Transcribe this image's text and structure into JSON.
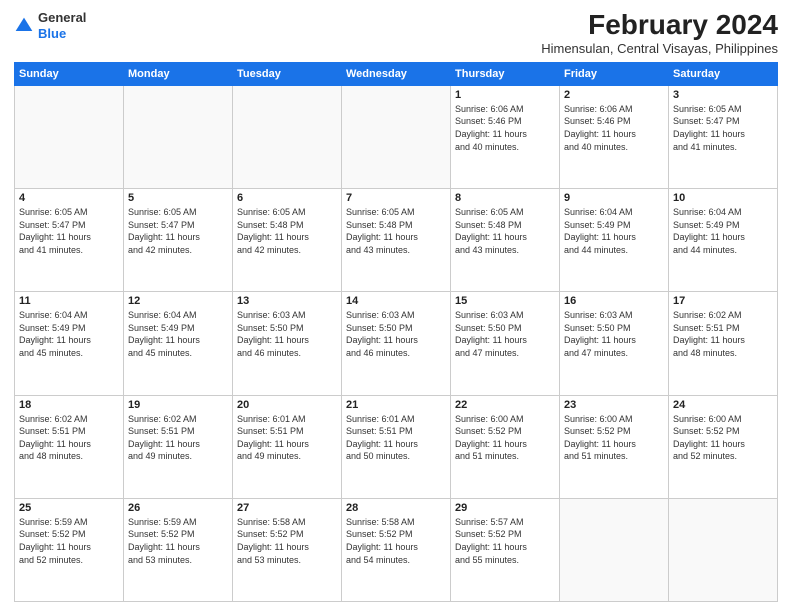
{
  "logo": {
    "general": "General",
    "blue": "Blue"
  },
  "header": {
    "month": "February 2024",
    "location": "Himensulan, Central Visayas, Philippines"
  },
  "weekdays": [
    "Sunday",
    "Monday",
    "Tuesday",
    "Wednesday",
    "Thursday",
    "Friday",
    "Saturday"
  ],
  "weeks": [
    [
      {
        "day": "",
        "info": ""
      },
      {
        "day": "",
        "info": ""
      },
      {
        "day": "",
        "info": ""
      },
      {
        "day": "",
        "info": ""
      },
      {
        "day": "1",
        "info": "Sunrise: 6:06 AM\nSunset: 5:46 PM\nDaylight: 11 hours\nand 40 minutes."
      },
      {
        "day": "2",
        "info": "Sunrise: 6:06 AM\nSunset: 5:46 PM\nDaylight: 11 hours\nand 40 minutes."
      },
      {
        "day": "3",
        "info": "Sunrise: 6:05 AM\nSunset: 5:47 PM\nDaylight: 11 hours\nand 41 minutes."
      }
    ],
    [
      {
        "day": "4",
        "info": "Sunrise: 6:05 AM\nSunset: 5:47 PM\nDaylight: 11 hours\nand 41 minutes."
      },
      {
        "day": "5",
        "info": "Sunrise: 6:05 AM\nSunset: 5:47 PM\nDaylight: 11 hours\nand 42 minutes."
      },
      {
        "day": "6",
        "info": "Sunrise: 6:05 AM\nSunset: 5:48 PM\nDaylight: 11 hours\nand 42 minutes."
      },
      {
        "day": "7",
        "info": "Sunrise: 6:05 AM\nSunset: 5:48 PM\nDaylight: 11 hours\nand 43 minutes."
      },
      {
        "day": "8",
        "info": "Sunrise: 6:05 AM\nSunset: 5:48 PM\nDaylight: 11 hours\nand 43 minutes."
      },
      {
        "day": "9",
        "info": "Sunrise: 6:04 AM\nSunset: 5:49 PM\nDaylight: 11 hours\nand 44 minutes."
      },
      {
        "day": "10",
        "info": "Sunrise: 6:04 AM\nSunset: 5:49 PM\nDaylight: 11 hours\nand 44 minutes."
      }
    ],
    [
      {
        "day": "11",
        "info": "Sunrise: 6:04 AM\nSunset: 5:49 PM\nDaylight: 11 hours\nand 45 minutes."
      },
      {
        "day": "12",
        "info": "Sunrise: 6:04 AM\nSunset: 5:49 PM\nDaylight: 11 hours\nand 45 minutes."
      },
      {
        "day": "13",
        "info": "Sunrise: 6:03 AM\nSunset: 5:50 PM\nDaylight: 11 hours\nand 46 minutes."
      },
      {
        "day": "14",
        "info": "Sunrise: 6:03 AM\nSunset: 5:50 PM\nDaylight: 11 hours\nand 46 minutes."
      },
      {
        "day": "15",
        "info": "Sunrise: 6:03 AM\nSunset: 5:50 PM\nDaylight: 11 hours\nand 47 minutes."
      },
      {
        "day": "16",
        "info": "Sunrise: 6:03 AM\nSunset: 5:50 PM\nDaylight: 11 hours\nand 47 minutes."
      },
      {
        "day": "17",
        "info": "Sunrise: 6:02 AM\nSunset: 5:51 PM\nDaylight: 11 hours\nand 48 minutes."
      }
    ],
    [
      {
        "day": "18",
        "info": "Sunrise: 6:02 AM\nSunset: 5:51 PM\nDaylight: 11 hours\nand 48 minutes."
      },
      {
        "day": "19",
        "info": "Sunrise: 6:02 AM\nSunset: 5:51 PM\nDaylight: 11 hours\nand 49 minutes."
      },
      {
        "day": "20",
        "info": "Sunrise: 6:01 AM\nSunset: 5:51 PM\nDaylight: 11 hours\nand 49 minutes."
      },
      {
        "day": "21",
        "info": "Sunrise: 6:01 AM\nSunset: 5:51 PM\nDaylight: 11 hours\nand 50 minutes."
      },
      {
        "day": "22",
        "info": "Sunrise: 6:00 AM\nSunset: 5:52 PM\nDaylight: 11 hours\nand 51 minutes."
      },
      {
        "day": "23",
        "info": "Sunrise: 6:00 AM\nSunset: 5:52 PM\nDaylight: 11 hours\nand 51 minutes."
      },
      {
        "day": "24",
        "info": "Sunrise: 6:00 AM\nSunset: 5:52 PM\nDaylight: 11 hours\nand 52 minutes."
      }
    ],
    [
      {
        "day": "25",
        "info": "Sunrise: 5:59 AM\nSunset: 5:52 PM\nDaylight: 11 hours\nand 52 minutes."
      },
      {
        "day": "26",
        "info": "Sunrise: 5:59 AM\nSunset: 5:52 PM\nDaylight: 11 hours\nand 53 minutes."
      },
      {
        "day": "27",
        "info": "Sunrise: 5:58 AM\nSunset: 5:52 PM\nDaylight: 11 hours\nand 53 minutes."
      },
      {
        "day": "28",
        "info": "Sunrise: 5:58 AM\nSunset: 5:52 PM\nDaylight: 11 hours\nand 54 minutes."
      },
      {
        "day": "29",
        "info": "Sunrise: 5:57 AM\nSunset: 5:52 PM\nDaylight: 11 hours\nand 55 minutes."
      },
      {
        "day": "",
        "info": ""
      },
      {
        "day": "",
        "info": ""
      }
    ]
  ]
}
